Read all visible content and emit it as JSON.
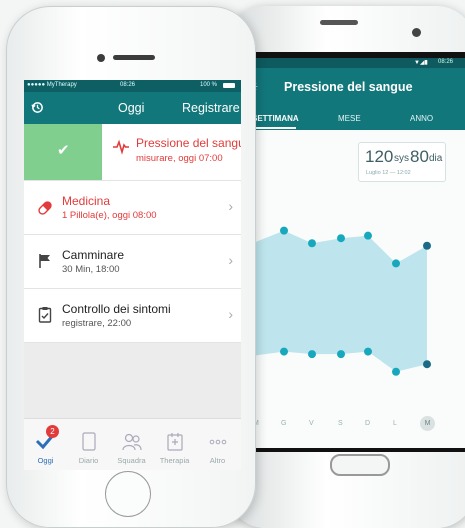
{
  "iphone": {
    "status": {
      "carrier": "●●●●● MyTherapy",
      "time": "08:26",
      "battery": "100 %"
    },
    "header": {
      "title": "Oggi",
      "action": "Registrare"
    },
    "items": [
      {
        "title": "Pressione del sangue",
        "subtitle": "misurare, oggi 07:00",
        "state": "completed"
      },
      {
        "title": "Medicina",
        "subtitle": "1 Pillola(e), oggi 08:00"
      },
      {
        "title": "Camminare",
        "subtitle": "30 Min, 18:00"
      },
      {
        "title": "Controllo dei sintomi",
        "subtitle": "registrare, 22:00"
      }
    ],
    "tabs": [
      {
        "label": "Oggi",
        "badge": "2"
      },
      {
        "label": "Diario"
      },
      {
        "label": "Squadra"
      },
      {
        "label": "Therapia"
      },
      {
        "label": "Altro"
      }
    ]
  },
  "android": {
    "status": {
      "time": "08:26"
    },
    "header": {
      "title": "Pressione del sangue"
    },
    "tabs": [
      "SETTIMANA",
      "MESE",
      "ANNO"
    ],
    "reading": {
      "sys_value": "120",
      "sys_unit": "sys",
      "dia_value": "80",
      "dia_unit": "dia",
      "date": "Luglio 12 — 12:02"
    },
    "days": [
      "M",
      "G",
      "V",
      "S",
      "D",
      "L",
      "M"
    ]
  },
  "chart_data": {
    "type": "area",
    "categories": [
      "M",
      "G",
      "V",
      "S",
      "D",
      "L",
      "M"
    ],
    "series": [
      {
        "values": [
          null,
          128,
          123,
          125,
          126,
          115,
          122
        ]
      },
      {
        "values": [
          null,
          80,
          79,
          79,
          80,
          72,
          75
        ]
      }
    ],
    "colors": {
      "band": "#a9dde8",
      "point": "#18a8bd",
      "last_point": "#1b6b86"
    }
  },
  "colors": {
    "teal": "#12777b",
    "red": "#e23b3b",
    "green_done": "#7fcf8e"
  }
}
